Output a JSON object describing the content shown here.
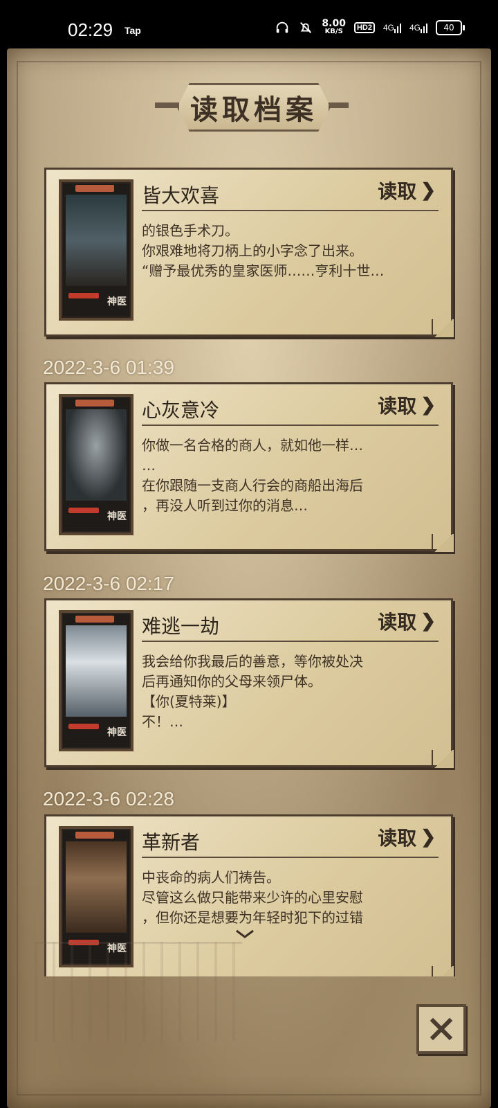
{
  "status_bar": {
    "time": "02:29",
    "notice": "Tap",
    "speed_value": "8.00",
    "speed_unit": "KB/S",
    "hd_label": "HD2",
    "net1": "4G",
    "net2": "4G",
    "battery": "40"
  },
  "header": {
    "title": "读取档案"
  },
  "saves": [
    {
      "date": "",
      "title": "皆大欢喜",
      "read_label": "读取",
      "body": "的银色手术刀。\n你艰难地将刀柄上的小字念了出来。\n“赠予最优秀的皇家医师……亨利十世…"
    },
    {
      "date": "2022-3-6  01:39",
      "title": "心灰意冷",
      "read_label": "读取",
      "body": "你做一名合格的商人，就如他一样…\n…\n在你跟随一支商人行会的商船出海后\n，再没人听到过你的消息…"
    },
    {
      "date": "2022-3-6  02:17",
      "title": "难逃一劫",
      "read_label": "读取",
      "body": "我会给你我最后的善意，等你被处决\n后再通知你的父母来领尸体。\n【你(夏特莱)】\n不！…"
    },
    {
      "date": "2022-3-6  02:28",
      "title": "革新者",
      "read_label": "读取",
      "body": "中丧命的病人们祷告。\n尽管这么做只能带来少许的心里安慰\n，但你还是想要为年轻时犯下的过错"
    }
  ],
  "thumb_logo": "神医",
  "scroll_hint_icon": "chevron-down-icon",
  "close_icon": "close-icon"
}
